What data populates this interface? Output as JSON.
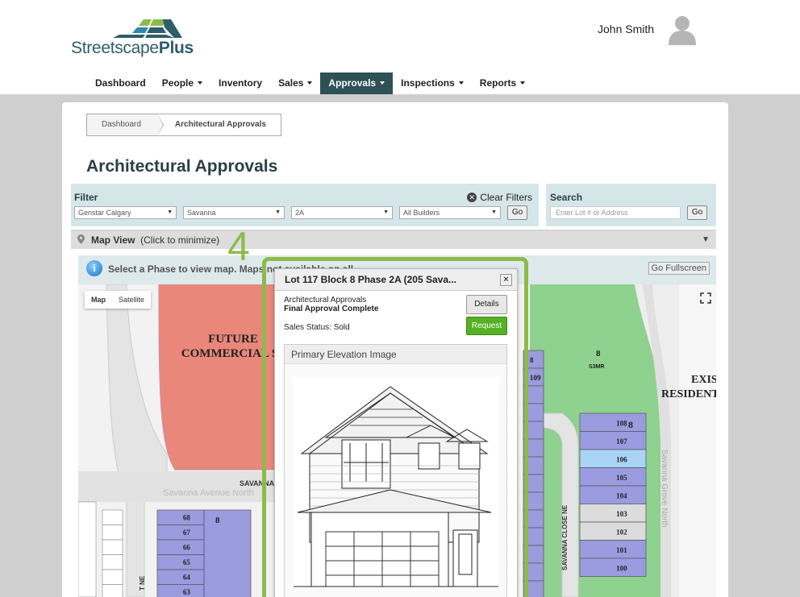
{
  "brand": {
    "name_light": "Streetscape",
    "name_bold": "Plus"
  },
  "user": {
    "name": "John Smith"
  },
  "nav": [
    {
      "label": "Dashboard",
      "dropdown": false,
      "active": false
    },
    {
      "label": "People",
      "dropdown": true,
      "active": false
    },
    {
      "label": "Inventory",
      "dropdown": false,
      "active": false
    },
    {
      "label": "Sales",
      "dropdown": true,
      "active": false
    },
    {
      "label": "Approvals",
      "dropdown": true,
      "active": true
    },
    {
      "label": "Inspections",
      "dropdown": true,
      "active": false
    },
    {
      "label": "Reports",
      "dropdown": true,
      "active": false
    }
  ],
  "breadcrumb": {
    "home": "Dashboard",
    "current": "Architectural Approvals"
  },
  "page_title": "Architectural Approvals",
  "filter": {
    "title": "Filter",
    "clear_label": "Clear Filters",
    "selects": [
      "Genstar Calgary",
      "Savanna",
      "2A",
      "All Builders"
    ],
    "go_label": "Go"
  },
  "search": {
    "title": "Search",
    "placeholder": "Enter Lot # or Address",
    "go_label": "Go"
  },
  "map_view": {
    "label": "Map View",
    "hint": "(Click to minimize)"
  },
  "phase_notice": {
    "text": "Select a Phase to view map. Maps not available on all...",
    "fullscreen_label": "Go Fullscreen"
  },
  "map": {
    "type_map": "Map",
    "type_satellite": "Satellite",
    "labels": {
      "future": "FUTURE",
      "commercial": "COMMERCIAL S",
      "existing": "EXISTIN",
      "resident": "RESIDENT",
      "block8": "8",
      "s3mr": "S3MR",
      "avenue": "SAVANNA AVENUE N",
      "avenue_faint": "Savanna Avenue North",
      "close": "SAVANNA CLOSE NE",
      "grove": "Savanna Grove North",
      "street_left": "T NE",
      "block8_left": "8",
      "block8_right": "8"
    },
    "lots_left": [
      "68",
      "67",
      "66",
      "65",
      "64",
      "63"
    ],
    "lots_right": [
      "108",
      "107",
      "106",
      "105",
      "104",
      "103",
      "102",
      "101",
      "100"
    ],
    "lots_col": [
      "8",
      "109"
    ]
  },
  "step_number": "4",
  "popup": {
    "title": "Lot 117 Block 8 Phase 2A (205 Sava...",
    "close": "×",
    "line1": "Architectural Approvals",
    "line2": "Final Approval Complete",
    "line3": "Sales Status: Sold",
    "details_label": "Details",
    "request_label": "Request",
    "image_title": "Primary Elevation Image"
  },
  "colors": {
    "nav_active": "#2d5156",
    "filter_bg": "#d5e6e9",
    "highlight": "#8dbb4a",
    "request_btn": "#56b023",
    "lot_purple": "#9b9be0",
    "lot_blue": "#a9d4f5",
    "park_green": "#8fd18f",
    "commercial": "#e9877a"
  }
}
